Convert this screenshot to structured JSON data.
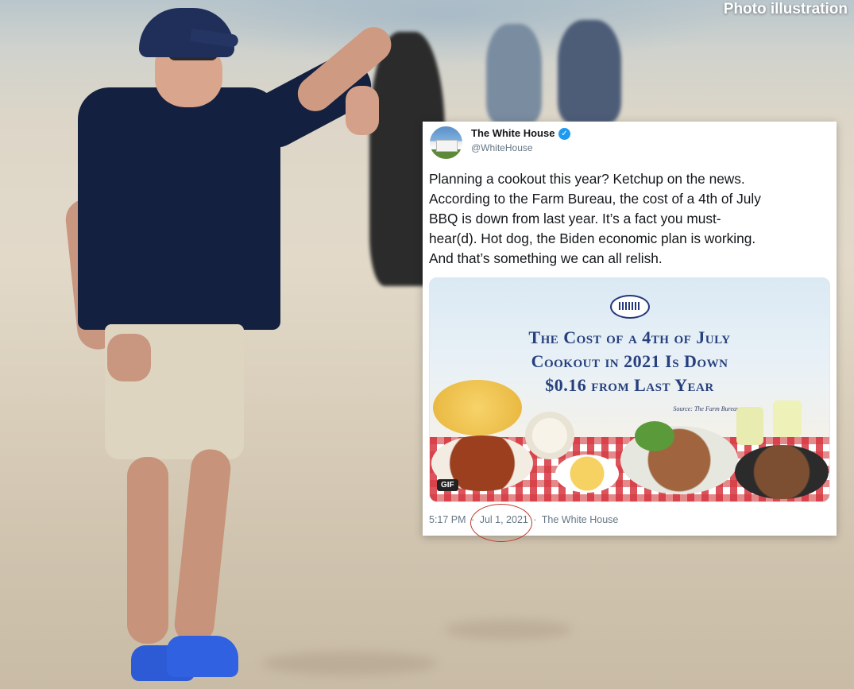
{
  "watermark": "Photo illustration",
  "tweet": {
    "author_name": "The White House",
    "author_handle": "@WhiteHouse",
    "verified": true,
    "body_lines": [
      "Planning a cookout this year? Ketchup on the news.",
      "According to the Farm Bureau, the cost of a 4th of July",
      "BBQ is down from last year. It’s a fact you must-",
      "hear(d). Hot dog, the Biden economic plan is working.",
      "And that’s something we can all relish."
    ],
    "media": {
      "heading_lines": [
        "The Cost of a 4th of July",
        "Cookout in 2021 Is Down",
        "$0.16 from Last Year"
      ],
      "source": "Source: The Farm Bureau",
      "badge": "GIF"
    },
    "time": "5:17 PM",
    "separator": "·",
    "date": "Jul 1, 2021",
    "source_label": "The White House"
  },
  "colors": {
    "heading": "#26407e",
    "verified": "#1d9bf0",
    "date_circle": "#c0392b",
    "shirt": "#14203f"
  }
}
